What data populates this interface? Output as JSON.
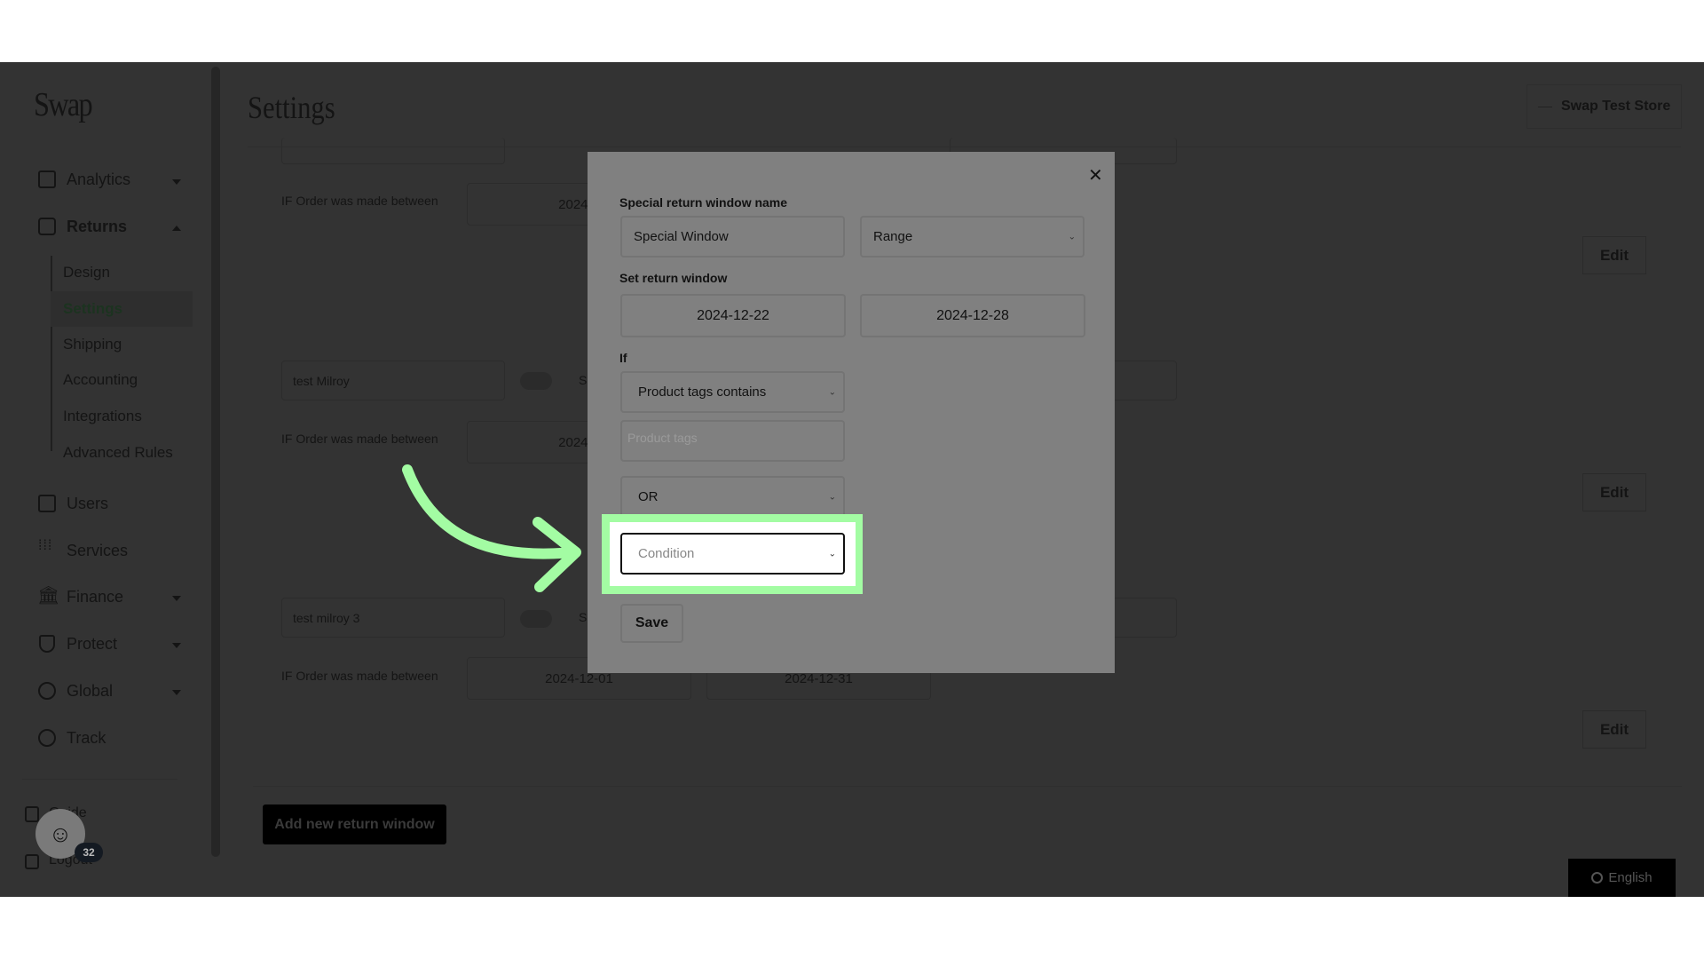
{
  "sidebar": {
    "logo": "Swap",
    "items": [
      {
        "label": "Analytics",
        "icon": "chart-icon",
        "expandable": true
      },
      {
        "label": "Returns",
        "icon": "box-icon",
        "expandable": true,
        "expanded": true
      },
      {
        "label": "Users",
        "icon": "user-icon"
      },
      {
        "label": "Services",
        "icon": "grid-icon"
      },
      {
        "label": "Finance",
        "icon": "bank-icon",
        "expandable": true
      },
      {
        "label": "Protect",
        "icon": "shield-icon",
        "expandable": true
      },
      {
        "label": "Global",
        "icon": "globe-icon",
        "expandable": true
      },
      {
        "label": "Track",
        "icon": "track-icon"
      }
    ],
    "returns_sub": [
      "Design",
      "Settings",
      "Shipping",
      "Accounting",
      "Integrations",
      "Advanced Rules"
    ],
    "active_sub": "Settings",
    "guide": "Guide",
    "logout": "Logout",
    "badge_count": "32"
  },
  "header": {
    "title": "Settings",
    "store": "Swap Test Store"
  },
  "windows": [
    {
      "name": "",
      "condition": "IF Order was made between",
      "start": "2024-1",
      "end": ""
    },
    {
      "name": "test Milroy",
      "condition": "IF Order was made between",
      "start": "2024-1",
      "end": "",
      "toggle_label": "S"
    },
    {
      "name": "test milroy 3",
      "condition": "IF Order was made between",
      "start": "2024-12-01",
      "end": "2024-12-31",
      "toggle_label": "S"
    }
  ],
  "edit_label": "Edit",
  "add_button": "Add new return window",
  "language": "English",
  "modal": {
    "name_label": "Special return window name",
    "name_value": "Special Window",
    "type_value": "Range",
    "window_label": "Set return window",
    "start_date": "2024-12-22",
    "end_date": "2024-12-28",
    "if_label": "If",
    "condition_type": "Product tags contains",
    "tags_placeholder": "Product tags",
    "operator": "OR",
    "condition_placeholder": "Condition",
    "save": "Save"
  },
  "colors": {
    "highlight": "#a3fca3",
    "overlay": "#333333",
    "modal": "#808080"
  }
}
